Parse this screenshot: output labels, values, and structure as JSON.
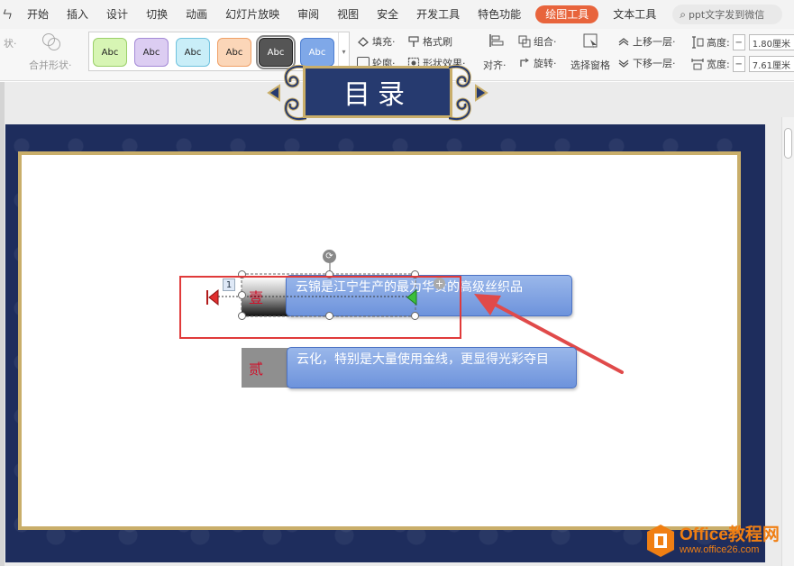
{
  "menu": {
    "items": [
      "ㄣ",
      "开始",
      "插入",
      "设计",
      "切换",
      "动画",
      "幻灯片放映",
      "审阅",
      "视图",
      "安全",
      "开发工具",
      "特色功能"
    ],
    "active": "绘图工具",
    "after": "文本工具",
    "search_placeholder": "ppt文字发到微信"
  },
  "ribbon": {
    "shape_label": "状·",
    "merge_label": "合并形状·",
    "swatches": [
      {
        "label": "Abc",
        "bg": "#d7f5b4",
        "border": "#9bd06a",
        "color": "#222222"
      },
      {
        "label": "Abc",
        "bg": "#dccdf2",
        "border": "#a48ad6",
        "color": "#222222"
      },
      {
        "label": "Abc",
        "bg": "#c9eef8",
        "border": "#6fc2de",
        "color": "#222222"
      },
      {
        "label": "Abc",
        "bg": "#fbd6b8",
        "border": "#f0a066",
        "color": "#222222"
      },
      {
        "label": "Abc",
        "bg": "#555555",
        "border": "#222222",
        "color": "#ffffff"
      },
      {
        "label": "Abc",
        "bg": "#7fa8e8",
        "border": "#4d7ed2",
        "color": "#ffffff"
      }
    ],
    "fill_label": "填充·",
    "format_painter_label": "格式刷",
    "outline_label": "轮廓·",
    "shape_effect_label": "形状效果·",
    "align_label": "对齐·",
    "group_label": "组合·",
    "rotate_label": "旋转·",
    "select_pane_label": "选择窗格",
    "bring_forward_label": "上移一层·",
    "send_backward_label": "下移一层·",
    "height_label": "高度:",
    "height_value": "1.80厘米",
    "width_label": "宽度:",
    "width_value": "7.61厘米"
  },
  "slide": {
    "title": "目录",
    "rows": [
      {
        "num": "壹",
        "text": "云锦是江宁生产的最为华贵的高级丝织品"
      },
      {
        "num": "贰",
        "text": "云化，特别是大量使用金线，更显得光彩夺目"
      }
    ],
    "order_badge": "1"
  },
  "watermark": {
    "line1": "Office教程网",
    "line2": "www.office26.com"
  }
}
